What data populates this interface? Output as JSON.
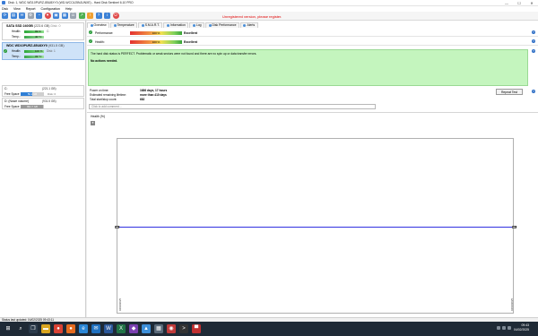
{
  "window": {
    "title": "Disk: 1, WDC WD10PURZ-85U8XY0 (WD-WCC4J5NJUNXE) - Hard Disk Sentinel 6.10 PRO",
    "controls": [
      "—",
      "☐",
      "✕"
    ]
  },
  "menu": [
    "Disk",
    "View",
    "Report",
    "Configuration",
    "Help"
  ],
  "toolbar": {
    "icons": [
      {
        "name": "refresh-icon",
        "glyph": "⟳",
        "color": "blue"
      },
      {
        "name": "save-icon",
        "glyph": "▤",
        "color": "blue"
      },
      {
        "name": "mail-icon",
        "glyph": "✉",
        "color": "blue"
      },
      {
        "name": "settings-icon",
        "glyph": "⚙",
        "color": "gray"
      },
      {
        "name": "gauge-icon",
        "glyph": "◔",
        "color": "blue"
      },
      {
        "name": "heart-icon",
        "glyph": "♥",
        "color": "red"
      },
      {
        "name": "test-icon",
        "glyph": "▣",
        "color": "blue"
      },
      {
        "name": "chart-icon",
        "glyph": "▦",
        "color": "blue"
      },
      {
        "name": "list-icon",
        "glyph": "☰",
        "color": "gray"
      },
      {
        "name": "graph-icon",
        "glyph": "↗",
        "color": "green"
      },
      {
        "name": "alert-icon",
        "glyph": "!",
        "color": "orange"
      },
      {
        "name": "help-icon",
        "glyph": "?",
        "color": "blue"
      },
      {
        "name": "info-icon",
        "glyph": "i",
        "color": "blue"
      },
      {
        "name": "power-icon",
        "glyph": "⏻",
        "color": "red"
      }
    ],
    "unregistered": "Unregistered version, please register."
  },
  "disks": [
    {
      "name": "SATA SSD 240GB",
      "capacity": "(223.6 GB)",
      "ext": "Disk: 0",
      "health_label": "Health:",
      "health": "99 %",
      "health_pct": 0.99,
      "health_ext": "C:",
      "temp_label": "Temp.:",
      "temp": "40 °C",
      "temp_pct": 0.4,
      "temp_ext": ""
    },
    {
      "name": "WDC WD10PURZ-85U8XY0",
      "capacity": "(931.5 GB)",
      "ext": "Disk: 1",
      "health_label": "Health:",
      "health": "100 %",
      "health_pct": 1.0,
      "health_ext": "Disk: 1",
      "temp_label": "Temp.:",
      "temp": "33 °C",
      "temp_pct": 0.33,
      "temp_ext": ""
    }
  ],
  "volumes": [
    {
      "name": "C:",
      "capacity": "(221.1 GB)",
      "ext": "Disk: 0",
      "free_label": "Free Space",
      "free": "50.2 GB",
      "free_pct": 0.5
    },
    {
      "name": "D: (Nowe volume)",
      "capacity": "(931.5 GB)",
      "ext": "",
      "free_label": "Free Space",
      "free": "891.7 GB",
      "free_pct": 0.96
    }
  ],
  "tabs": [
    {
      "label": "Overview",
      "active": true
    },
    {
      "label": "Temperature",
      "active": false
    },
    {
      "label": "S.M.A.R.T.",
      "active": false
    },
    {
      "label": "Information",
      "active": false
    },
    {
      "label": "Log",
      "active": false
    },
    {
      "label": "Disk Performance",
      "active": false
    },
    {
      "label": "Alerts",
      "active": false
    }
  ],
  "performance": {
    "label": "Performance:",
    "value": "100 %",
    "rating": "Excellent"
  },
  "health": {
    "label": "Health:",
    "value": "100 %",
    "rating": "Excellent"
  },
  "status_box": {
    "message": "The hard disk status is PERFECT. Problematic or weak sectors were not found and there are no spin up or data transfer errors.",
    "action": "No actions needed."
  },
  "info": [
    {
      "label": "Power on time:",
      "value": "1686 days, 17 hours"
    },
    {
      "label": "Estimated remaining lifetime:",
      "value": "more than 410 days"
    },
    {
      "label": "Total start/stop count:",
      "value": "682"
    }
  ],
  "report_button": "Repeat Test",
  "comment_placeholder": "Click to add comment ...",
  "graph": {
    "title": "Health (%)",
    "button": "▾"
  },
  "chart_data": {
    "type": "line",
    "x": [
      "04/02/2025",
      "04/02/2025"
    ],
    "series": [
      {
        "values": [
          100,
          100
        ]
      }
    ],
    "point_labels": [
      "100",
      "100"
    ],
    "ylim": [
      0,
      200
    ],
    "grid": false
  },
  "statusbar": "Status last updated: 04/02/2025 09:43:11",
  "taskbar": {
    "time": "09:43",
    "date": "04/02/2025",
    "apps": [
      {
        "name": "start-icon",
        "glyph": "⊞",
        "color": "#1f2a36"
      },
      {
        "name": "search-taskbar-icon",
        "glyph": "⌕",
        "color": "#1f2a36"
      },
      {
        "name": "taskview-icon",
        "glyph": "❐",
        "color": "#2b3a4a"
      },
      {
        "name": "explorer-icon",
        "glyph": "▬",
        "color": "#d9a520"
      },
      {
        "name": "chrome-icon",
        "glyph": "●",
        "color": "#d94234"
      },
      {
        "name": "firefox-icon",
        "glyph": "●",
        "color": "#e56b1f"
      },
      {
        "name": "edge-icon",
        "glyph": "e",
        "color": "#2a86d6"
      },
      {
        "name": "mail-taskbar-icon",
        "glyph": "✉",
        "color": "#1e70c0"
      },
      {
        "name": "word-icon",
        "glyph": "W",
        "color": "#2b579a"
      },
      {
        "name": "excel-icon",
        "glyph": "X",
        "color": "#217346"
      },
      {
        "name": "app-icon",
        "glyph": "◆",
        "color": "#7a3fb0"
      },
      {
        "name": "photos-icon",
        "glyph": "▲",
        "color": "#3d8fd9"
      },
      {
        "name": "store-icon",
        "glyph": "▦",
        "color": "#5a6a7a"
      },
      {
        "name": "hds-taskbar-icon",
        "glyph": "◉",
        "color": "#c03a3a"
      },
      {
        "name": "terminal-icon",
        "glyph": ">",
        "color": "#333"
      },
      {
        "name": "flag-icon",
        "glyph": "▀",
        "color": "#c03030"
      }
    ]
  }
}
